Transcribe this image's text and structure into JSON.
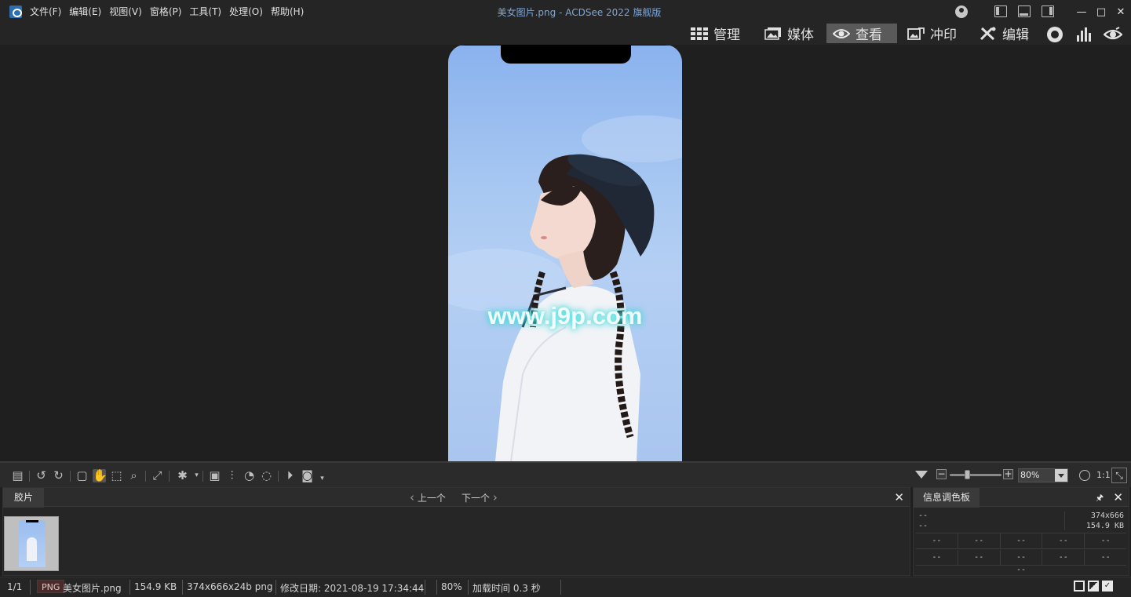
{
  "window": {
    "title": "美女图片.png - ACDSee 2022 旗舰版",
    "minimize": "—",
    "maximize": "□",
    "close": "✕"
  },
  "menu": [
    "文件(F)",
    "编辑(E)",
    "视图(V)",
    "窗格(P)",
    "工具(T)",
    "处理(O)",
    "帮助(H)"
  ],
  "modes": {
    "manage": "管理",
    "media": "媒体",
    "view": "查看",
    "develop": "冲印",
    "edit": "编辑",
    "active": "view"
  },
  "viewer": {
    "watermark": "www.j9p.com"
  },
  "toolbar": {
    "zoom_value": "80%",
    "zoom_level": 0.8,
    "actual_size": "1:1"
  },
  "filmstrip": {
    "tab": "胶片",
    "prev": "上一个",
    "next": "下一个"
  },
  "info_palette": {
    "tab": "信息调色板",
    "left1": "--",
    "left2": "--",
    "dimensions": "374x666",
    "filesize": "154.9 KB",
    "row1": [
      "--",
      "--",
      "--",
      "--",
      "--"
    ],
    "row2": [
      "--",
      "--",
      "--",
      "--",
      "--"
    ],
    "bottom": "--"
  },
  "status": {
    "index": "1/1",
    "format": "PNG",
    "filename": "美女图片.png",
    "filesize": "154.9 KB",
    "dimensions": "374x666x24b png",
    "modified": "修改日期: 2021-08-19 17:34:44",
    "zoom": "80%",
    "load_time": "加载时间 0.3 秒"
  },
  "colors": {
    "accent_title": "#7fa6d6",
    "active_mode_bg": "#5a5a5a",
    "background": "#1f1f1f"
  }
}
